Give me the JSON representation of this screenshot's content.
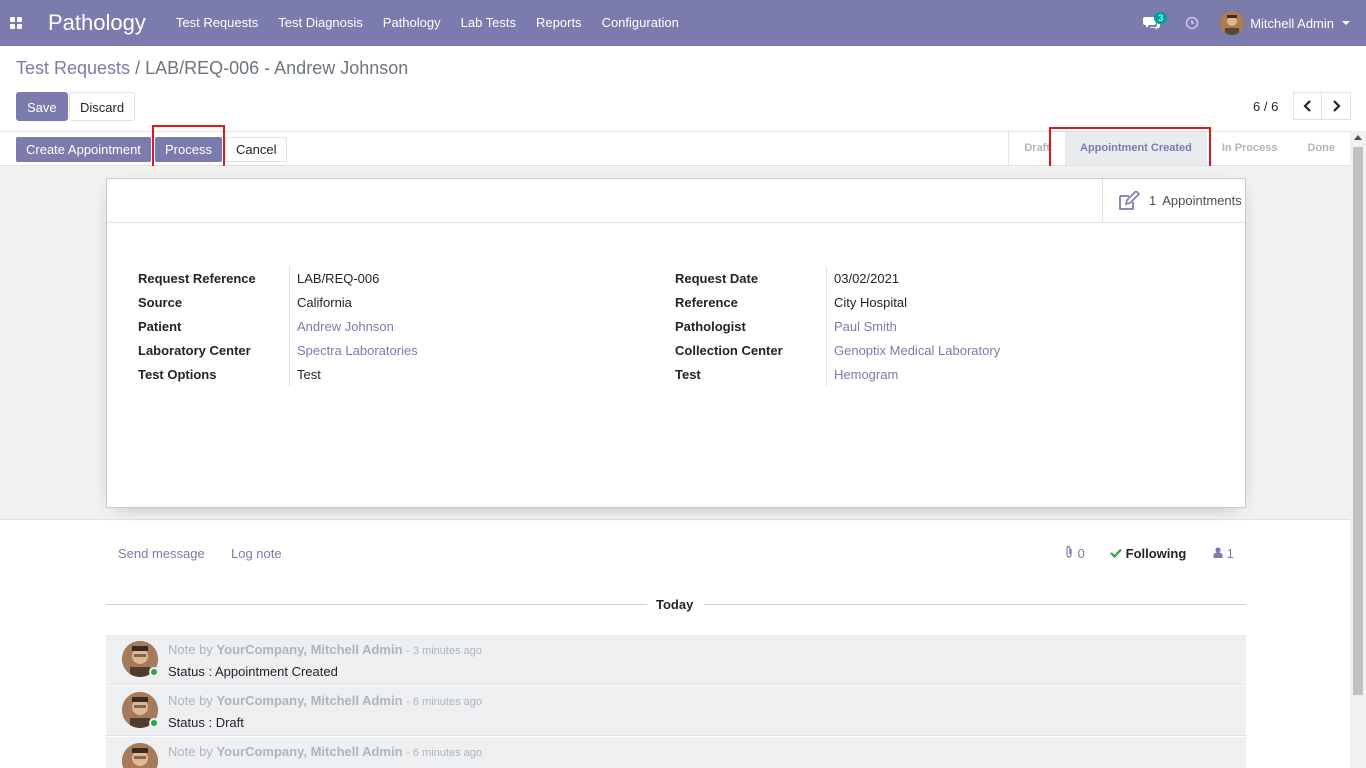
{
  "navbar": {
    "brand": "Pathology",
    "menu": [
      "Test Requests",
      "Test Diagnosis",
      "Pathology",
      "Lab Tests",
      "Reports",
      "Configuration"
    ],
    "chat_badge": "3",
    "user_name": "Mitchell Admin"
  },
  "breadcrumb": {
    "parent": "Test Requests",
    "separator": "/",
    "current": "LAB/REQ-006 - Andrew Johnson"
  },
  "actions": {
    "save": "Save",
    "discard": "Discard"
  },
  "pager": {
    "value": "6 / 6"
  },
  "statusbar": {
    "buttons": {
      "create": "Create Appointment",
      "process": "Process",
      "cancel": "Cancel"
    },
    "stages": [
      "Draft",
      "Appointment Created",
      "In Process",
      "Done"
    ],
    "active_stage": "Appointment Created"
  },
  "smart_button": {
    "count": "1",
    "label": "Appointments"
  },
  "fields_left": [
    {
      "label": "Request Reference",
      "value": "LAB/REQ-006",
      "link": false
    },
    {
      "label": "Source",
      "value": "California",
      "link": false
    },
    {
      "label": "Patient",
      "value": "Andrew Johnson",
      "link": true
    },
    {
      "label": "Laboratory Center",
      "value": "Spectra Laboratories",
      "link": true
    },
    {
      "label": "Test Options",
      "value": "Test",
      "link": false
    }
  ],
  "fields_right": [
    {
      "label": "Request Date",
      "value": "03/02/2021",
      "link": false
    },
    {
      "label": "Reference",
      "value": "City Hospital",
      "link": false
    },
    {
      "label": "Pathologist",
      "value": "Paul Smith",
      "link": true
    },
    {
      "label": "Collection Center",
      "value": "Genoptix Medical Laboratory",
      "link": true
    },
    {
      "label": "Test",
      "value": "Hemogram",
      "link": true
    }
  ],
  "chatter": {
    "send_message": "Send message",
    "log_note": "Log note",
    "attachments": "0",
    "following": "Following",
    "followers": "1",
    "today": "Today",
    "messages": [
      {
        "prefix": "Note by",
        "author": "YourCompany, Mitchell Admin",
        "time": "- 3 minutes ago",
        "body": "Status : Appointment Created"
      },
      {
        "prefix": "Note by",
        "author": "YourCompany, Mitchell Admin",
        "time": "- 6 minutes ago",
        "body": "Status : Draft"
      },
      {
        "prefix": "Note by",
        "author": "YourCompany, Mitchell Admin",
        "time": "- 6 minutes ago",
        "body": ""
      }
    ]
  },
  "colors": {
    "brand": "#7c7bad",
    "highlight": "#e4161c",
    "online": "#28a745",
    "badge": "#00a09d"
  }
}
